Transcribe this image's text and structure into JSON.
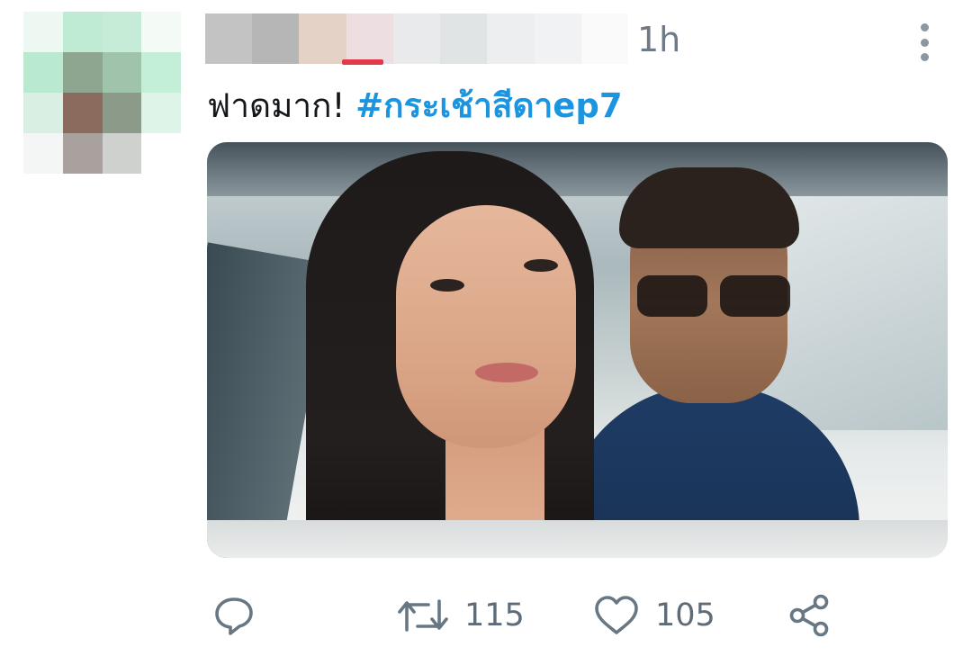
{
  "tweet": {
    "time": "1h",
    "text_plain": "ฟาดมาก! ",
    "hashtag": "#กระเช้าสีดาep7",
    "colors": {
      "hashtag": "#1b95e0",
      "text": "#14171a",
      "meta": "#6f7a86"
    }
  },
  "icons": {
    "more": "kebab-vertical-icon",
    "reply": "reply-bubble-icon",
    "retweet": "retweet-icon",
    "like": "heart-icon",
    "share": "share-icon"
  },
  "actions": {
    "retweets": "115",
    "likes": "105"
  }
}
